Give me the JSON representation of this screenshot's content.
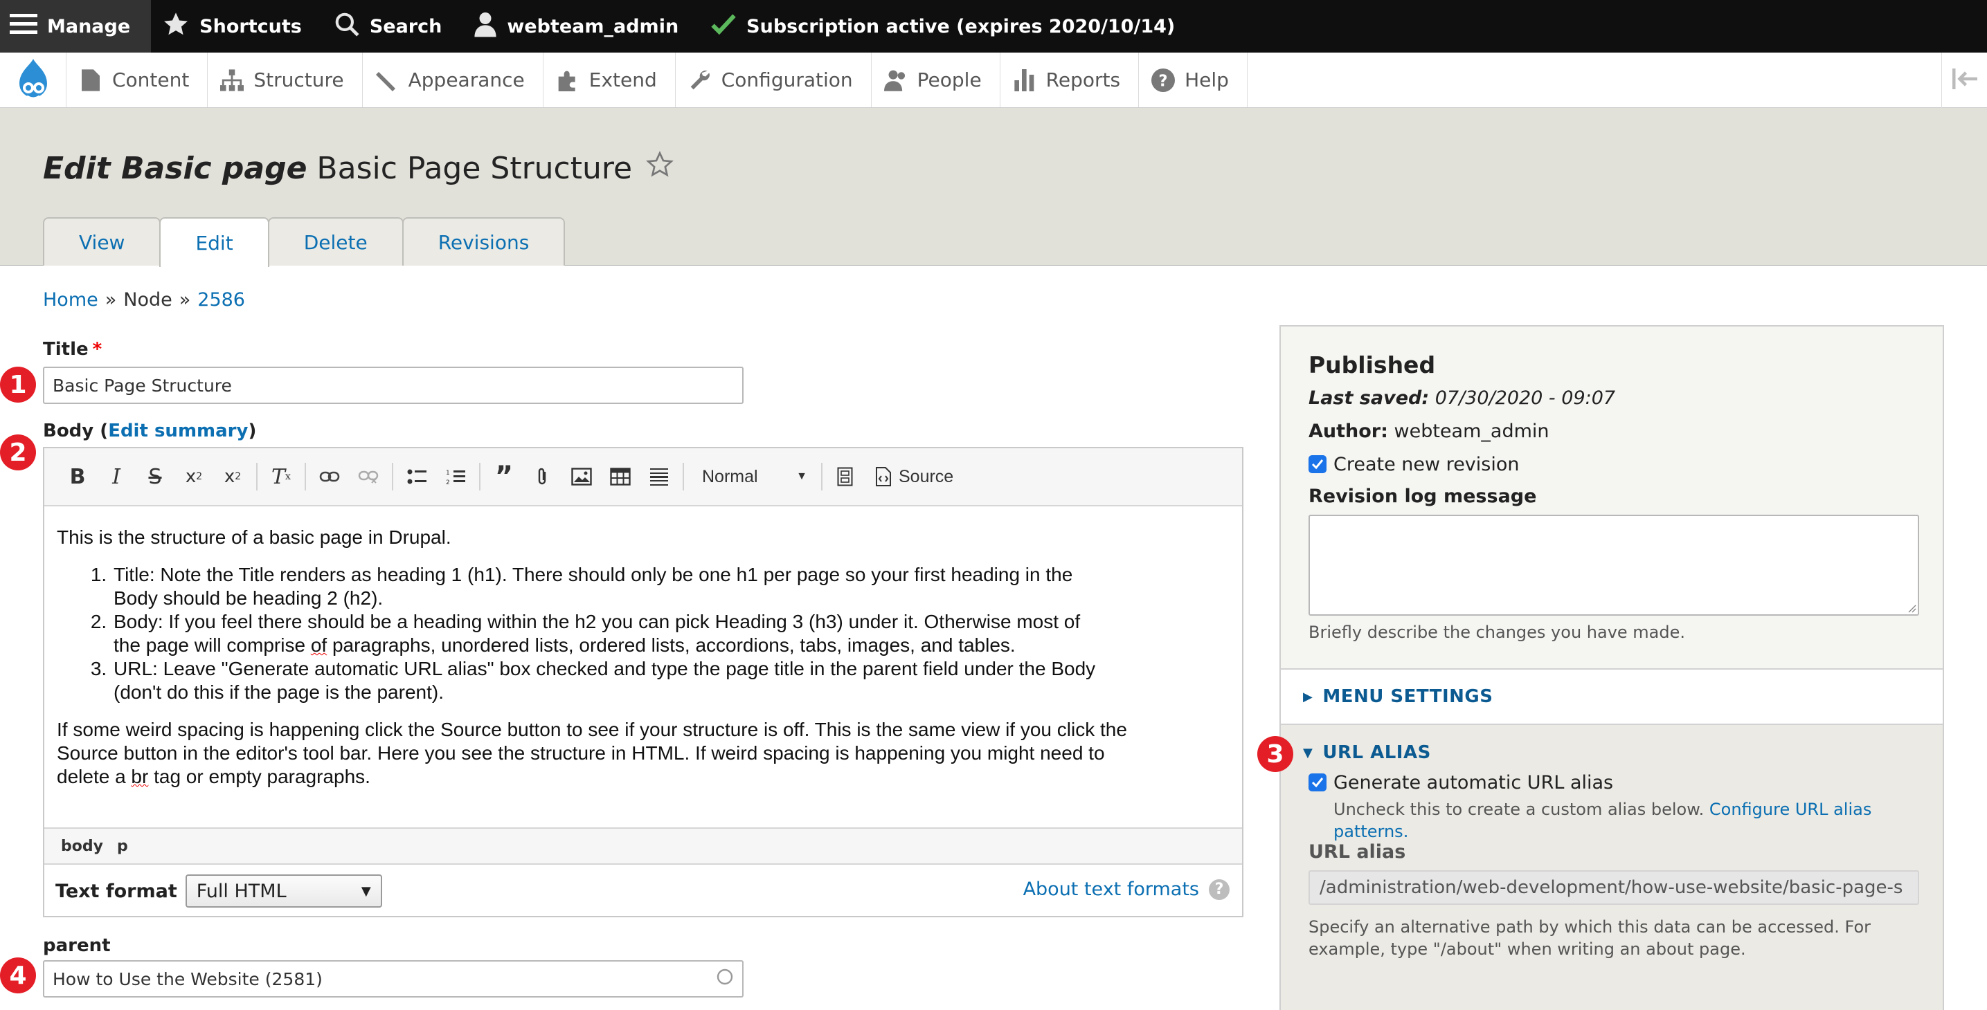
{
  "toolbar": {
    "manage": "Manage",
    "shortcuts": "Shortcuts",
    "search": "Search",
    "user": "webteam_admin",
    "subscription": "Subscription active (expires 2020/10/14)"
  },
  "tray": {
    "items": [
      {
        "label": "Content",
        "icon": "content-icon"
      },
      {
        "label": "Structure",
        "icon": "structure-icon"
      },
      {
        "label": "Appearance",
        "icon": "appearance-icon"
      },
      {
        "label": "Extend",
        "icon": "extend-icon"
      },
      {
        "label": "Configuration",
        "icon": "configuration-icon"
      },
      {
        "label": "People",
        "icon": "people-icon"
      },
      {
        "label": "Reports",
        "icon": "reports-icon"
      },
      {
        "label": "Help",
        "icon": "help-icon"
      }
    ]
  },
  "header": {
    "title_prefix": "Edit Basic page",
    "title": "Basic Page Structure",
    "tabs": [
      "View",
      "Edit",
      "Delete",
      "Revisions"
    ],
    "active_tab": "Edit"
  },
  "breadcrumb": {
    "home": "Home",
    "sep": "»",
    "node": "Node",
    "id": "2586"
  },
  "form": {
    "title_label": "Title",
    "required_mark": "*",
    "title_value": "Basic Page Structure",
    "body_label": "Body",
    "edit_summary": "Edit summary",
    "editor": {
      "format_value": "Normal",
      "source_label": "Source",
      "intro": "This is the structure of a basic page in Drupal.",
      "list": [
        {
          "line1": "Title: Note the Title renders as heading 1 (h1). There should only be one h1 per page so your first heading in the",
          "line2": "Body should be heading 2 (h2)."
        },
        {
          "line1": "Body: If you feel there should be a heading within the h2 you can pick Heading 3 (h3) under it. Otherwise most of",
          "line2a": "the page will comprise ",
          "line2b": "of",
          "line2c": " paragraphs, unordered lists, ordered lists, accordions, tabs, images, and tables."
        },
        {
          "line1": "URL: Leave \"Generate automatic URL alias\" box checked and type the page title in the parent field under the Body",
          "line2": "(don't do this if the page is the parent)."
        }
      ],
      "para_line1": "If some weird spacing is happening click the Source button to see if your structure is off. This is the same view if you click the",
      "para_line2": "Source button in the editor's tool bar. Here you see the structure in HTML. If weird spacing is happening you might need to",
      "para_line3a": "delete a ",
      "para_line3b": "br",
      "para_line3c": " tag or empty paragraphs.",
      "path": [
        "body",
        "p"
      ]
    },
    "text_format_label": "Text format",
    "text_format_value": "Full HTML",
    "about_text_formats": "About text formats",
    "parent_label": "parent",
    "parent_value": "How to Use the Website (2581)"
  },
  "badges": [
    "1",
    "2",
    "3",
    "4"
  ],
  "sidebar": {
    "status": "Published",
    "last_saved_label": "Last saved:",
    "last_saved_value": "07/30/2020 - 09:07",
    "author_label": "Author:",
    "author_value": "webteam_admin",
    "create_revision": "Create new revision",
    "revlog_label": "Revision log message",
    "revlog_hint": "Briefly describe the changes you have made.",
    "menu_settings": "MENU SETTINGS",
    "url_alias_head": "URL ALIAS",
    "generate_alias": "Generate automatic URL alias",
    "uncheck_hint": "Uncheck this to create a custom alias below.",
    "configure_link_1": "Configure URL alias",
    "configure_link_2": "patterns.",
    "url_alias_label": "URL alias",
    "url_alias_value": "/administration/web-development/how-use-website/basic-page-s",
    "url_hint_1": "Specify an alternative path by which this data can be accessed. For",
    "url_hint_2": "example, type \"/about\" when writing an about page."
  },
  "colors": {
    "toolbar_bg": "#0f0f0f",
    "header_bg": "#e1e0d9",
    "link": "#0b6fb2",
    "badge": "#e41e26",
    "check": "#1a73e8"
  }
}
